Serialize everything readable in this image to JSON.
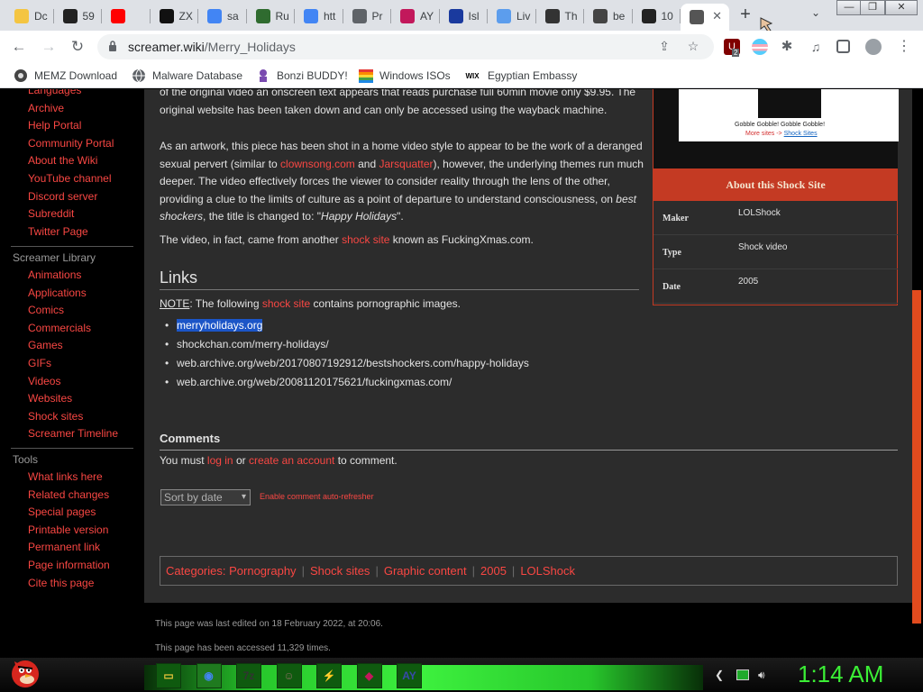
{
  "tabs": [
    {
      "label": "Dc",
      "icon": "ghost-tab-icon",
      "color": "#f4c542"
    },
    {
      "label": "59",
      "icon": "b-tab-icon",
      "color": "#222222"
    },
    {
      "label": "",
      "icon": "youtube-tab-icon",
      "color": "#ff0000"
    },
    {
      "label": "ZX",
      "icon": "zx-tab-icon",
      "color": "#111111"
    },
    {
      "label": "sa",
      "icon": "google-tab-icon",
      "color": "#4285f4"
    },
    {
      "label": "Ru",
      "icon": "game-tab-icon",
      "color": "#2f6b2f"
    },
    {
      "label": "htt",
      "icon": "google-tab-icon",
      "color": "#4285f4"
    },
    {
      "label": "Pr",
      "icon": "globe-tab-icon",
      "color": "#5f6368"
    },
    {
      "label": "AY",
      "icon": "ay-tab-icon",
      "color": "#c2185b"
    },
    {
      "label": "Isl",
      "icon": "ir-tab-icon",
      "color": "#1a3a9e"
    },
    {
      "label": "Liv",
      "icon": "share-tab-icon",
      "color": "#5c9ded"
    },
    {
      "label": "Th",
      "icon": "chart-tab-icon",
      "color": "#333333"
    },
    {
      "label": "be",
      "icon": "photo-tab-icon",
      "color": "#444444"
    },
    {
      "label": "10",
      "icon": "ten-tab-icon",
      "color": "#222222"
    },
    {
      "label": "",
      "icon": "screamer-tab-icon",
      "color": "#555555",
      "active": true
    }
  ],
  "toolbar": {
    "url_domain": "screamer.wiki",
    "url_path": "/Merry_Holidays",
    "ext_badge": "2"
  },
  "bookmarks": [
    {
      "label": "MEMZ Download",
      "icon": "memz-icon"
    },
    {
      "label": "Malware Database",
      "icon": "globe-icon"
    },
    {
      "label": "Bonzi BUDDY!",
      "icon": "bonzi-icon"
    },
    {
      "label": "Windows ISOs",
      "icon": "windows-icon"
    },
    {
      "label": "Egyptian Embassy",
      "icon": "wix-icon",
      "icon_text": "WIX"
    }
  ],
  "sidebar": {
    "top_links": [
      "Languages",
      "Archive",
      "Help Portal",
      "Community Portal",
      "About the Wiki",
      "YouTube channel",
      "Discord server",
      "Subreddit",
      "Twitter Page"
    ],
    "library_heading": "Screamer Library",
    "library_links": [
      "Animations",
      "Applications",
      "Comics",
      "Commercials",
      "Games",
      "GIFs",
      "Videos",
      "Websites",
      "Shock sites",
      "Screamer Timeline"
    ],
    "tools_heading": "Tools",
    "tools_links": [
      "What links here",
      "Related changes",
      "Special pages",
      "Printable version",
      "Permanent link",
      "Page information",
      "Cite this page"
    ]
  },
  "article": {
    "para1": "of the original video an onscreen text appears that reads purchase full 60min movie only $9.95. The original website has been taken down and can only be accessed using the wayback machine.",
    "para2_a": "As an artwork, this piece has been shot in a home video style to appear to be the work of a deranged sexual pervert (similar to ",
    "para2_link1": "clownsong.com",
    "para2_b": " and ",
    "para2_link2": "Jarsquatter",
    "para2_c": "), however, the underlying themes run much deeper. The video effectively forces the viewer to consider reality through the lens of the other, providing a clue to the limits of culture as a point of departure to understand consciousness, on ",
    "para2_italic": "best shockers",
    "para2_d": ", the title is changed to: \"",
    "para2_italic2": "Happy Holidays",
    "para2_e": "\".",
    "para3_a": "The video, in fact, came from another ",
    "para3_link": "shock site",
    "para3_b": " known as FuckingXmas.com.",
    "links_heading": "Links",
    "note_label": "NOTE",
    "note_a": ": The following ",
    "note_link": "shock site",
    "note_b": " contains pornographic images.",
    "links": [
      "merryholidays.org",
      "shockchan.com/merry-holidays/",
      "web.archive.org/web/20170807192912/bestshockers.com/happy-holidays",
      "web.archive.org/web/20081120175621/fuckingxmas.com/"
    ]
  },
  "infobox": {
    "image_caption": "Gobble Gobble! Gobble Gobble!",
    "image_link_a": "More sites ->",
    "image_link_b": "Shock Sites",
    "title": "About this Shock Site",
    "rows": [
      {
        "key": "Maker",
        "value": "LOLShock"
      },
      {
        "key": "Type",
        "value": "Shock video"
      },
      {
        "key": "Date",
        "value": "2005"
      }
    ]
  },
  "comments": {
    "heading": "Comments",
    "note_a": "You must ",
    "login": "log in",
    "note_b": " or ",
    "create": "create an account",
    "note_c": " to comment.",
    "sort_value": "Sort by date",
    "refresher": "Enable comment auto-refresher"
  },
  "categories": {
    "label": "Categories:",
    "items": [
      "Pornography",
      "Shock sites",
      "Graphic content",
      "2005",
      "LOLShock"
    ]
  },
  "footer": {
    "last_edited": "This page was last edited on 18 February 2022, at 20:06.",
    "accessed": "This page has been accessed 11,329 times."
  },
  "taskbar": {
    "clock": "1:14 AM",
    "apps": [
      "folder-icon",
      "chrome-icon",
      "7zip-icon",
      "bonzi-icon",
      "winamp-icon",
      "lips-icon",
      "ay-icon"
    ]
  }
}
